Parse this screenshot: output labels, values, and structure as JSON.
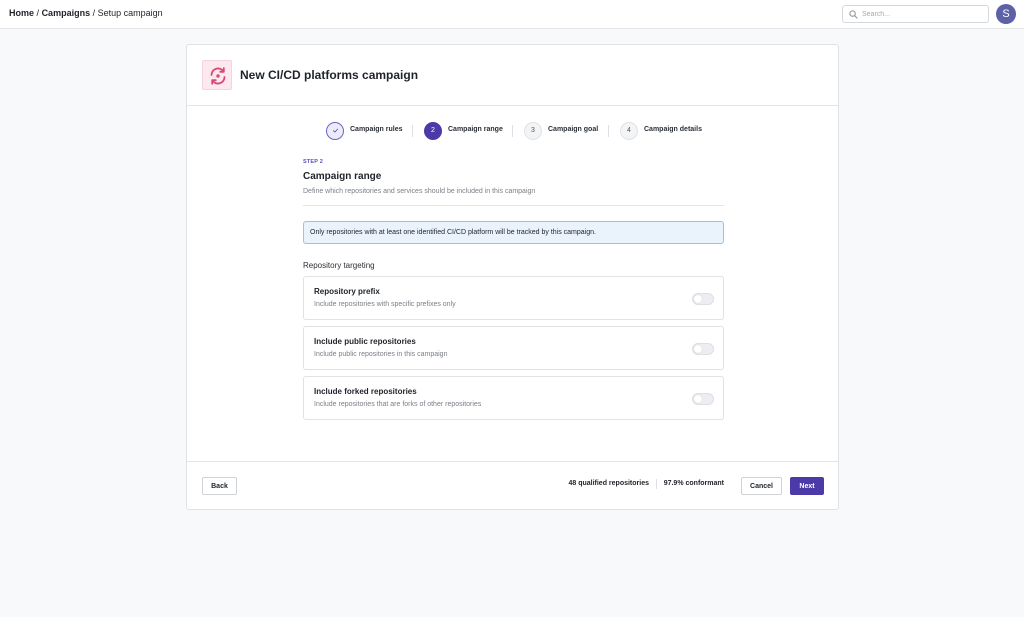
{
  "breadcrumb": {
    "home": "Home",
    "sep1": "/",
    "campaigns": "Campaigns",
    "sep2": "/",
    "current": "Setup campaign"
  },
  "search": {
    "placeholder": "Search...",
    "value": ""
  },
  "user": {
    "avatar_initial": "S"
  },
  "campaign": {
    "title": "New CI/CD platforms campaign",
    "icon": "sync-icon",
    "icon_color": "#d9487a"
  },
  "stepper": {
    "steps": [
      {
        "number": "",
        "label": "Campaign rules",
        "status": "done"
      },
      {
        "number": "2",
        "label": "Campaign range",
        "status": "active"
      },
      {
        "number": "3",
        "label": "Campaign goal",
        "status": "pending"
      },
      {
        "number": "4",
        "label": "Campaign details",
        "status": "pending"
      }
    ]
  },
  "section": {
    "step_tag": "STEP 2",
    "title": "Campaign range",
    "description": "Define which repositories and services should be included in this campaign"
  },
  "info_banner": {
    "text": "Only repositories with at least one identified CI/CD platform will be tracked by this campaign."
  },
  "targeting": {
    "label": "Repository targeting",
    "options": [
      {
        "title": "Repository prefix",
        "description": "Include repositories with specific prefixes only",
        "enabled": false
      },
      {
        "title": "Include public repositories",
        "description": "Include public repositories in this campaign",
        "enabled": false
      },
      {
        "title": "Include forked repositories",
        "description": "Include repositories that are forks of other repositories",
        "enabled": false
      }
    ]
  },
  "stats": {
    "qualified": "48 qualified repositories",
    "conformant": "97.9% conformant"
  },
  "footer": {
    "back_label": "Back",
    "cancel_label": "Cancel",
    "next_label": "Next"
  },
  "colors": {
    "accent": "#4c3aa8",
    "info_bg": "#eaf2fc",
    "info_border": "#9cc2ea"
  }
}
